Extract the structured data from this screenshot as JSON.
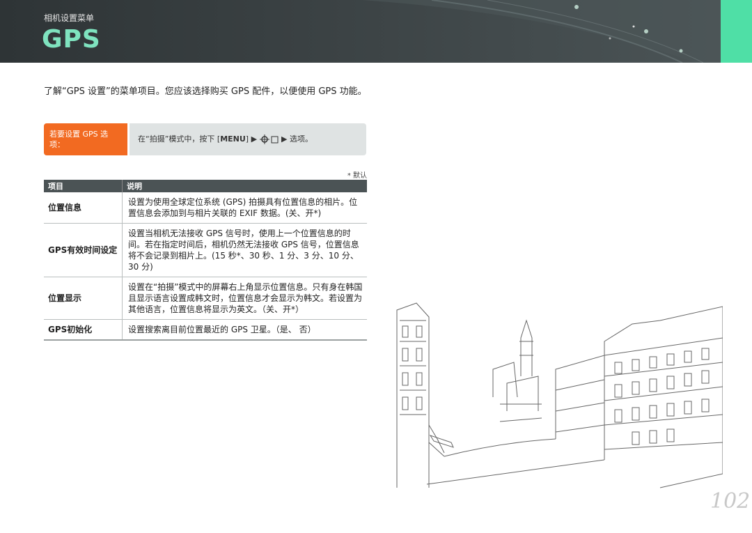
{
  "header": {
    "section": "相机设置菜单",
    "title": "GPS"
  },
  "intro": "了解“GPS 设置”的菜单项目。您应该选择购买 GPS 配件，以便使用 GPS 功能。",
  "tip": {
    "label": "若要设置 GPS 选项：",
    "text_prefix": "在“拍摄”模式中，按下 [",
    "menu_key": "MENU",
    "text_mid": "] ▶ ",
    "text_suffix": " ▶ 选项。"
  },
  "default_note": "* 默认",
  "table": {
    "headers": [
      "项目",
      "说明"
    ],
    "rows": [
      {
        "item": "位置信息",
        "desc": "设置为使用全球定位系统 (GPS) 拍摄具有位置信息的相片。位置信息会添加到与相片关联的 EXIF 数据。(关、开*)"
      },
      {
        "item": "GPS有效时间设定",
        "desc": "设置当相机无法接收 GPS 信号时，使用上一个位置信息的时间。若在指定时间后，相机仍然无法接收 GPS 信号，位置信息将不会记录到相片上。(15 秒*、30 秒、1 分、3 分、10 分、30 分)"
      },
      {
        "item": "位置显示",
        "desc": "设置在“拍摄”模式中的屏幕右上角显示位置信息。只有身在韩国且显示语言设置成韩文时，位置信息才会显示为韩文。若设置为其他语言，位置信息将显示为英文。（关、开*）"
      },
      {
        "item": "GPS初始化",
        "desc": "设置搜索离目前位置最近的 GPS 卫星。（是、 否）"
      }
    ]
  },
  "page_number": "102",
  "colors": {
    "accent_green": "#4fdfa6",
    "tip_orange": "#f26a21",
    "header_dark": "#2e3436"
  }
}
